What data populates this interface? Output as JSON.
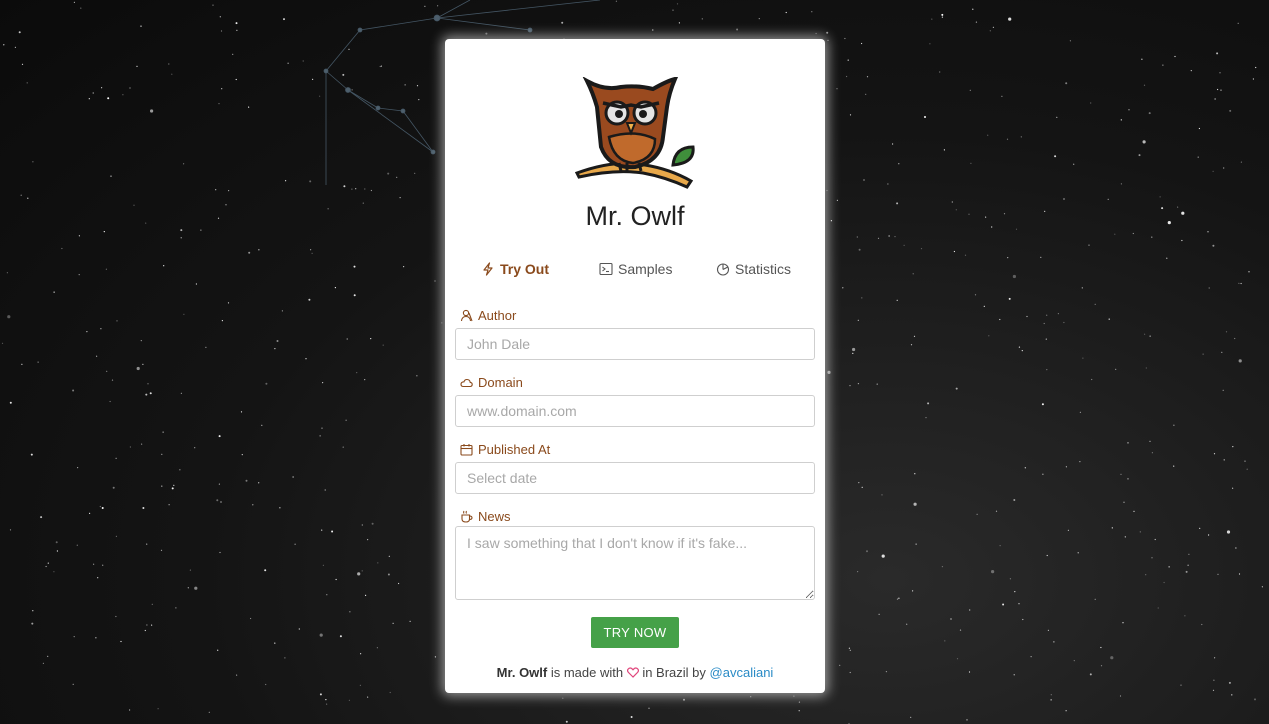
{
  "app": {
    "title": "Mr. Owlf"
  },
  "logo": {
    "icon": "owl-on-branch-logo"
  },
  "tabs": [
    {
      "label": "Try Out",
      "icon": "lightning-icon",
      "active": true
    },
    {
      "label": "Samples",
      "icon": "terminal-icon",
      "active": false
    },
    {
      "label": "Statistics",
      "icon": "pie-chart-icon",
      "active": false
    }
  ],
  "form": {
    "author": {
      "label": "Author",
      "placeholder": "John Dale",
      "value": ""
    },
    "domain": {
      "label": "Domain",
      "placeholder": "www.domain.com",
      "value": ""
    },
    "published_at": {
      "label": "Published At",
      "placeholder": "Select date",
      "value": ""
    },
    "news": {
      "label": "News",
      "placeholder": "I saw something that I don't know if it's fake...",
      "value": ""
    },
    "submit_label": "Try now"
  },
  "footer": {
    "brand": "Mr. Owlf",
    "text_before": " is made with ",
    "text_after": " in Brazil by ",
    "author_link": "@avcaliani"
  },
  "colors": {
    "accent": "#8a4a1c",
    "button": "#45a148",
    "link": "#2a8bc6",
    "heart": "#e0457b"
  }
}
